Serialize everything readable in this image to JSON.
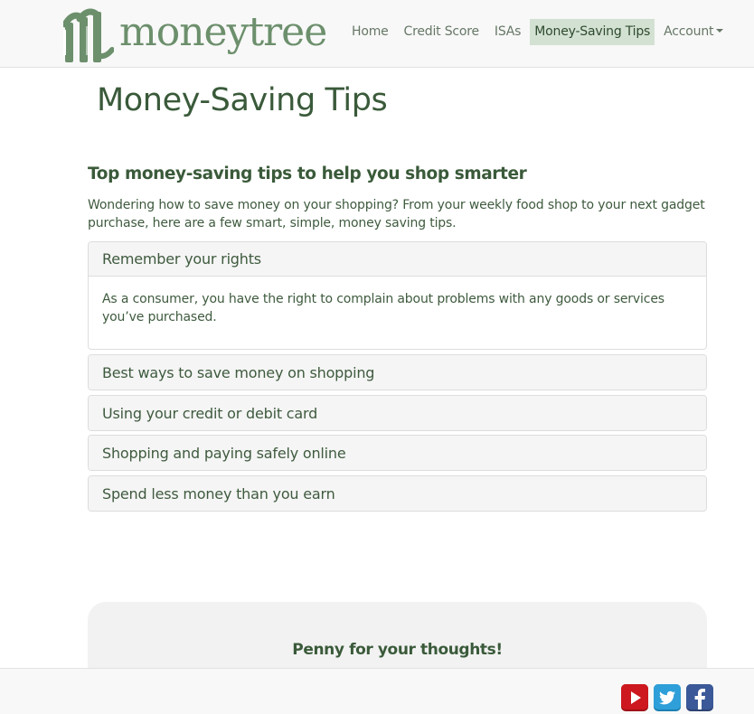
{
  "brand": {
    "name": "moneytree"
  },
  "nav": {
    "items": [
      {
        "label": "Home"
      },
      {
        "label": "Credit Score"
      },
      {
        "label": "ISAs"
      },
      {
        "label": "Money-Saving Tips"
      },
      {
        "label": "Account"
      }
    ],
    "active_color": "#d3e1d3"
  },
  "page": {
    "title": "Money-Saving Tips",
    "section_heading": "Top money-saving tips to help you shop smarter",
    "intro": "Wondering how to save money on your shopping? From your weekly food shop to your next gadget purchase, here are a few smart, simple, money saving tips."
  },
  "accordion": [
    {
      "title": "Remember your rights",
      "body": "As a consumer, you have the right to complain about problems with any goods or services you’ve purchased."
    },
    {
      "title": "Best ways to save money on shopping"
    },
    {
      "title": "Using your credit or debit card"
    },
    {
      "title": "Shopping and paying safely online"
    },
    {
      "title": "Spend less money than you earn"
    }
  ],
  "feedback": {
    "title": "Penny for your thoughts!"
  },
  "footer": {
    "social": [
      {
        "icon": "youtube-icon",
        "color": "#cc181e"
      },
      {
        "icon": "twitter-icon",
        "color": "#2e9fd8"
      },
      {
        "icon": "facebook-icon",
        "color": "#3b5998"
      }
    ]
  }
}
